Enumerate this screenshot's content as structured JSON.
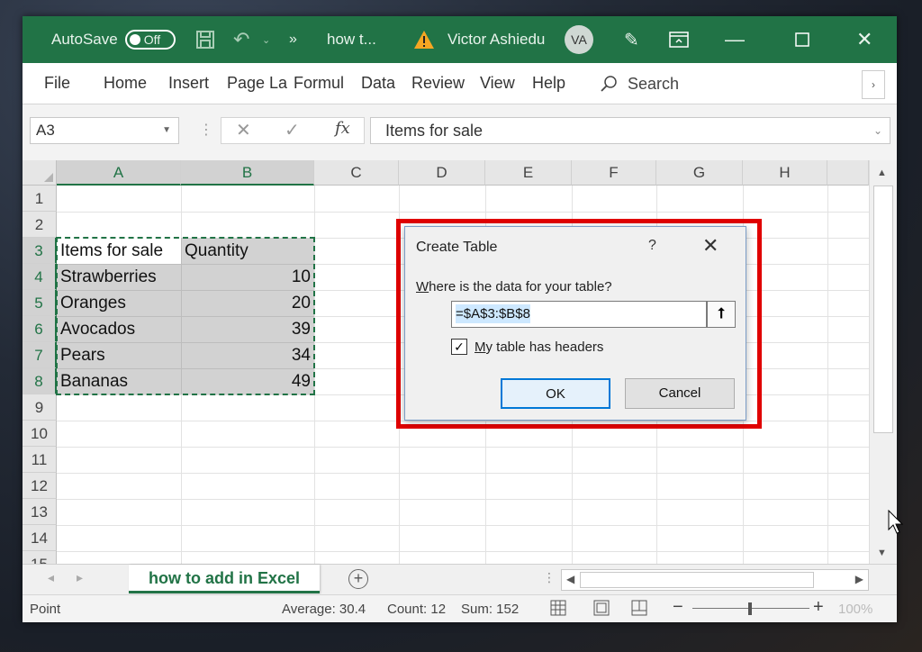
{
  "titlebar": {
    "autosave_label": "AutoSave",
    "autosave_state": "Off",
    "doc_title": "how t...",
    "user_name": "Victor Ashiedu",
    "user_initials": "VA",
    "accent": "#217346"
  },
  "ribbon": {
    "tabs": [
      "File",
      "Home",
      "Insert",
      "Page La",
      "Formul",
      "Data",
      "Review",
      "View",
      "Help"
    ],
    "search_label": "Search"
  },
  "formula_bar": {
    "name_box": "A3",
    "formula": "Items for sale",
    "fx": "fx"
  },
  "grid": {
    "columns": [
      "A",
      "B",
      "C",
      "D",
      "E",
      "F",
      "G",
      "H"
    ],
    "rows": [
      "1",
      "2",
      "3",
      "4",
      "5",
      "6",
      "7",
      "8",
      "9",
      "10",
      "11",
      "12",
      "13",
      "14",
      "15"
    ],
    "cells": [
      {
        "a": "Items for sale",
        "b": "Quantity"
      },
      {
        "a": "Strawberries",
        "b": "10"
      },
      {
        "a": "Oranges",
        "b": "20"
      },
      {
        "a": "Avocados",
        "b": "39"
      },
      {
        "a": "Pears",
        "b": "34"
      },
      {
        "a": "Bananas",
        "b": "49"
      }
    ]
  },
  "sheets": {
    "active": "how to add in Excel",
    "add_label": "+"
  },
  "statusbar": {
    "mode": "Point",
    "average": "Average: 30.4",
    "count": "Count: 12",
    "sum": "Sum: 152",
    "zoom": "100%"
  },
  "dialog": {
    "title": "Create Table",
    "help": "?",
    "question_prefix": "W",
    "question_rest": "here is the data for your table?",
    "range": "=$A$3:$B$8",
    "checkbox_prefix": "M",
    "checkbox_rest": "y table has headers",
    "checkbox_checked": true,
    "ok_label": "OK",
    "cancel_label": "Cancel",
    "highlight_color": "#e00000"
  }
}
